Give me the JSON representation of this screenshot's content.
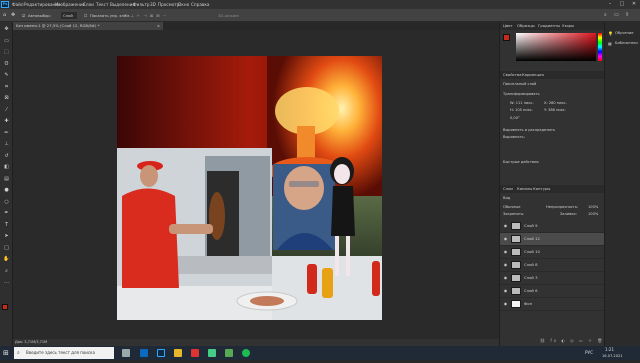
{
  "app": {
    "menu": [
      "Файл",
      "Редактирование",
      "Изображение",
      "Слои",
      "Текст",
      "Выделение",
      "Фильтр",
      "3D",
      "Просмотр",
      "Окно",
      "Справка"
    ]
  },
  "options": {
    "tool_label": "Автовыбор:",
    "tool_select": "Слой",
    "show_controls": "Показать упр. элем.",
    "mode3d": "3D-режим:"
  },
  "document": {
    "tab_title": "Без имени-1 @ 27,5% (Слой 12, RGB/8#) *",
    "status": "Док: 3,71M/3,71M"
  },
  "tools": [
    "move-tool",
    "artboard-tool",
    "marquee-tool",
    "lasso-tool",
    "quick-select-tool",
    "crop-tool",
    "frame-tool",
    "eyedropper-tool",
    "healing-tool",
    "brush-tool",
    "stamp-tool",
    "history-brush-tool",
    "eraser-tool",
    "gradient-tool",
    "blur-tool",
    "dodge-tool",
    "pen-tool",
    "type-tool",
    "path-select-tool",
    "rectangle-tool",
    "hand-tool",
    "zoom-tool",
    "more-tools-icon"
  ],
  "color_panel": {
    "tabs": [
      "Цвет",
      "Образцы",
      "Градиенты",
      "Узоры"
    ],
    "fg": "#c92a1a",
    "bg": "#ffffff"
  },
  "properties_panel": {
    "tabs": [
      "Свойства",
      "Коррекция"
    ],
    "layer_type": "Пиксельный слой",
    "section": "Трансформировать",
    "w": "W: 111 пикс.",
    "h": "H: 105 пикс.",
    "x": "X: 280 пикс.",
    "y": "Y: 386 пикс.",
    "angle": "0,00°",
    "align_section": "Выровнять и распределить",
    "align_label": "Выровнять:",
    "quick_actions": "Быстрые действия"
  },
  "layers_panel": {
    "tabs": [
      "Слои",
      "Каналы",
      "Контуры"
    ],
    "kind": "Вид",
    "blend": "Обычные",
    "opacity_label": "Непрозрачность:",
    "opacity": "100%",
    "lock_label": "Закрепить:",
    "fill_label": "Заливка:",
    "fill": "100%",
    "layers": [
      {
        "name": "Слой 9",
        "selected": false
      },
      {
        "name": "Слой 12",
        "selected": true
      },
      {
        "name": "Слой 10",
        "selected": false
      },
      {
        "name": "Слой 8",
        "selected": false
      },
      {
        "name": "Слой 3",
        "selected": false
      },
      {
        "name": "Слой 6",
        "selected": false
      },
      {
        "name": "Фон",
        "selected": false
      }
    ]
  },
  "side_panel": {
    "items": [
      "Обучение",
      "Библиотеки"
    ]
  },
  "taskbar": {
    "search": "Введите здесь текст для поиска",
    "lang": "РУС",
    "time": "1:21",
    "date": "16.07.2021"
  }
}
